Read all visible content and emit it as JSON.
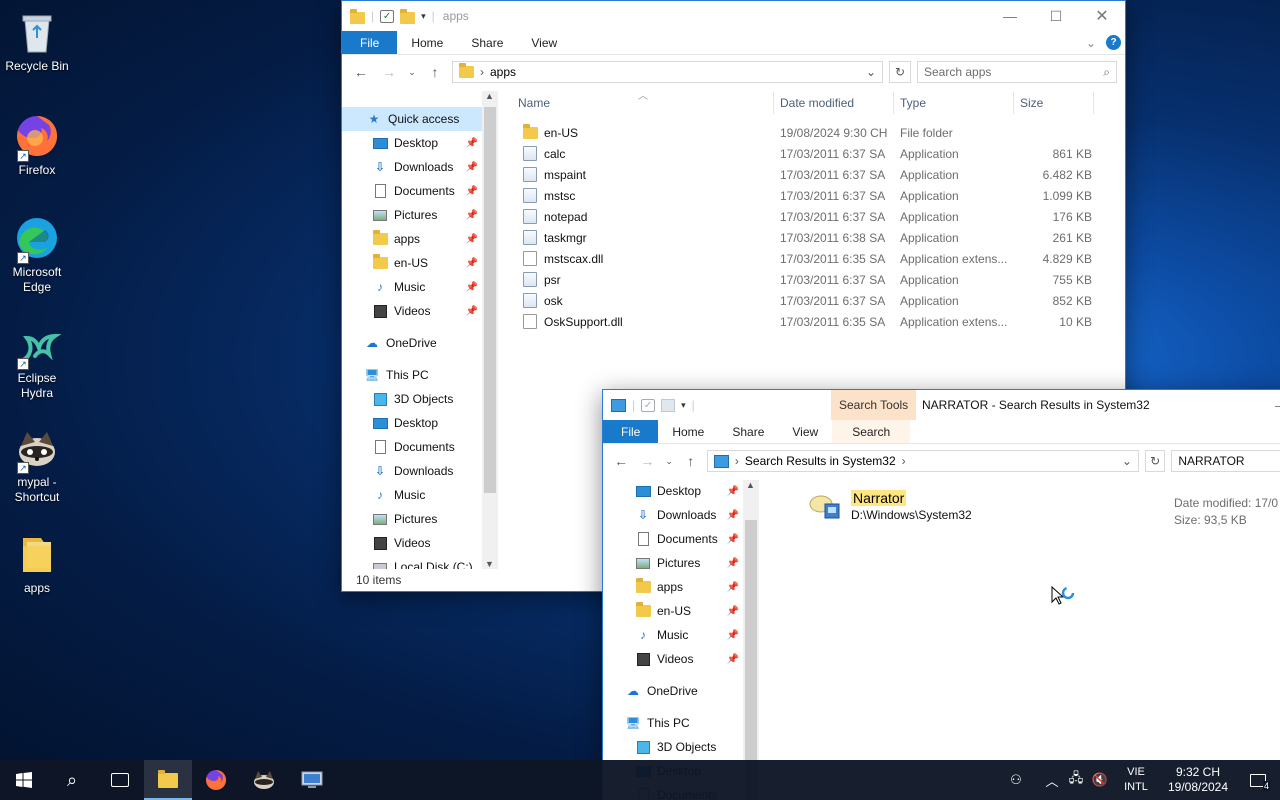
{
  "desktop": {
    "icons": [
      {
        "label": "Recycle Bin",
        "icon": "recycle-bin-icon"
      },
      {
        "label": "Firefox",
        "icon": "firefox-icon"
      },
      {
        "label": "Microsoft Edge",
        "icon": "edge-icon"
      },
      {
        "label": "Eclipse Hydra",
        "icon": "hydra-icon"
      },
      {
        "label": "mypal - Shortcut",
        "icon": "mypal-icon"
      },
      {
        "label": "apps",
        "icon": "folder-icon"
      }
    ]
  },
  "window1": {
    "title": "apps",
    "tabs": {
      "file": "File",
      "home": "Home",
      "share": "Share",
      "view": "View"
    },
    "address": "apps",
    "search_placeholder": "Search apps",
    "nav": {
      "quick_access": "Quick access",
      "qa_items": [
        "Desktop",
        "Downloads",
        "Documents",
        "Pictures",
        "apps",
        "en-US",
        "Music",
        "Videos"
      ],
      "onedrive": "OneDrive",
      "this_pc": "This PC",
      "pc_items": [
        "3D Objects",
        "Desktop",
        "Documents",
        "Downloads",
        "Music",
        "Pictures",
        "Videos",
        "Local Disk (C:)"
      ]
    },
    "columns": {
      "name": "Name",
      "date": "Date modified",
      "type": "Type",
      "size": "Size"
    },
    "files": [
      {
        "name": "en-US",
        "date": "19/08/2024 9:30 CH",
        "type": "File folder",
        "size": "",
        "kind": "folder"
      },
      {
        "name": "calc",
        "date": "17/03/2011 6:37 SA",
        "type": "Application",
        "size": "861 KB",
        "kind": "app"
      },
      {
        "name": "mspaint",
        "date": "17/03/2011 6:37 SA",
        "type": "Application",
        "size": "6.482 KB",
        "kind": "app"
      },
      {
        "name": "mstsc",
        "date": "17/03/2011 6:37 SA",
        "type": "Application",
        "size": "1.099 KB",
        "kind": "app"
      },
      {
        "name": "notepad",
        "date": "17/03/2011 6:37 SA",
        "type": "Application",
        "size": "176 KB",
        "kind": "app"
      },
      {
        "name": "taskmgr",
        "date": "17/03/2011 6:38 SA",
        "type": "Application",
        "size": "261 KB",
        "kind": "app"
      },
      {
        "name": "mstscax.dll",
        "date": "17/03/2011 6:35 SA",
        "type": "Application extens...",
        "size": "4.829 KB",
        "kind": "dll"
      },
      {
        "name": "psr",
        "date": "17/03/2011 6:37 SA",
        "type": "Application",
        "size": "755 KB",
        "kind": "app"
      },
      {
        "name": "osk",
        "date": "17/03/2011 6:37 SA",
        "type": "Application",
        "size": "852 KB",
        "kind": "app"
      },
      {
        "name": "OskSupport.dll",
        "date": "17/03/2011 6:35 SA",
        "type": "Application extens...",
        "size": "10 KB",
        "kind": "dll"
      }
    ],
    "status": "10 items"
  },
  "window2": {
    "context_tab": "Search Tools",
    "title": "NARRATOR - Search Results in System32",
    "tabs": {
      "file": "File",
      "home": "Home",
      "share": "Share",
      "view": "View",
      "search": "Search"
    },
    "address": "Search Results in System32",
    "search_value": "NARRATOR",
    "nav": {
      "qa_items": [
        "Desktop",
        "Downloads",
        "Documents",
        "Pictures",
        "apps",
        "en-US",
        "Music",
        "Videos"
      ],
      "onedrive": "OneDrive",
      "this_pc": "This PC",
      "pc_items": [
        "3D Objects",
        "Desktop",
        "Documents"
      ]
    },
    "result": {
      "name": "Narrator",
      "path": "D:\\Windows\\System32",
      "date_label": "Date modified: 17/0",
      "size_label": "Size: 93,5 KB"
    }
  },
  "taskbar": {
    "lang_top": "VIE",
    "lang_bottom": "INTL",
    "time": "9:32 CH",
    "date": "19/08/2024",
    "notifications": "4"
  }
}
